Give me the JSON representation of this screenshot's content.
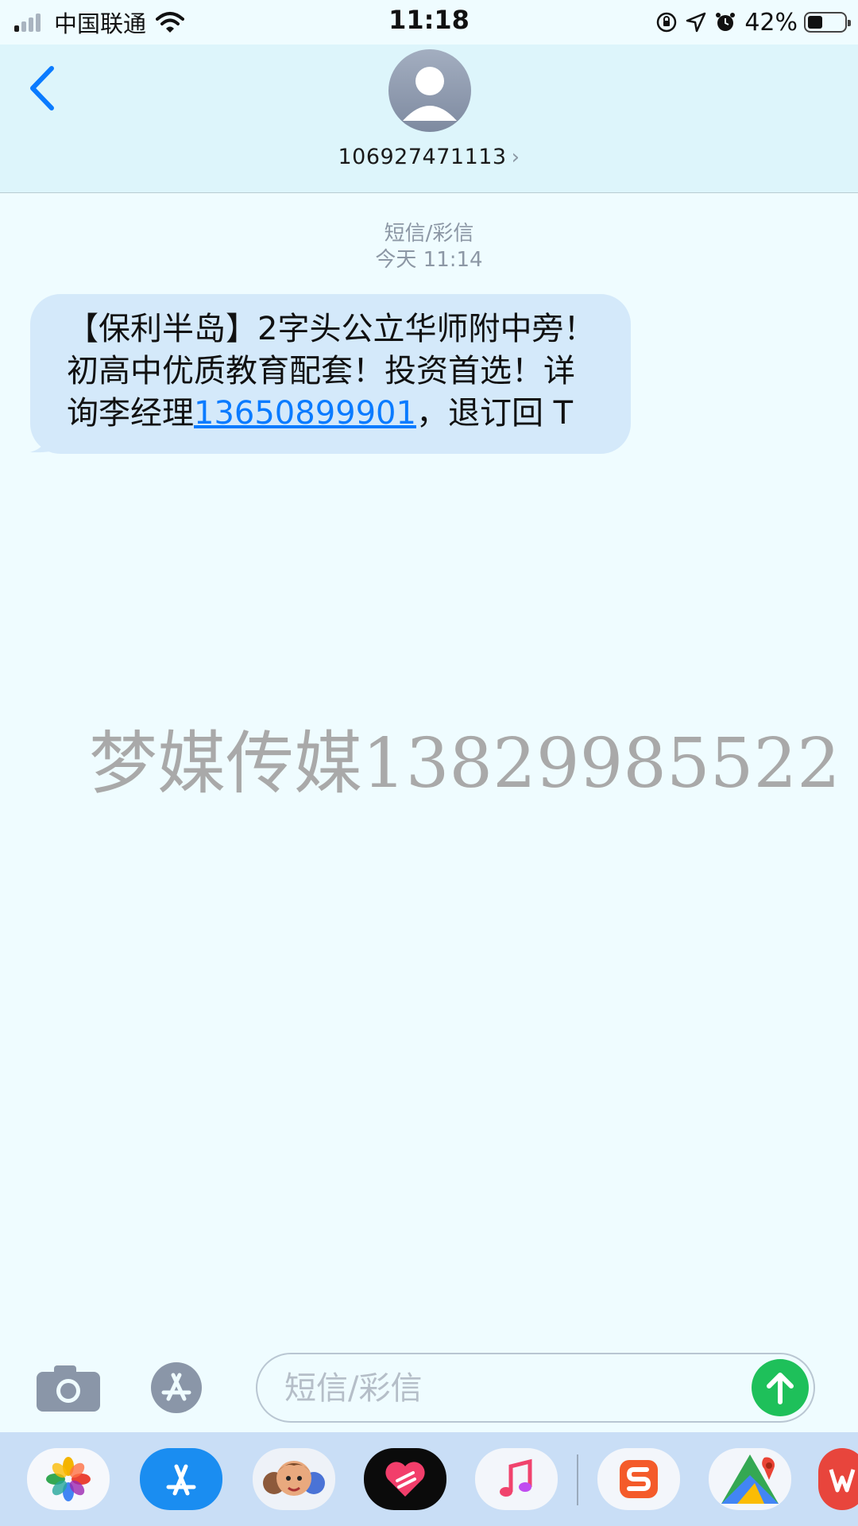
{
  "status_bar": {
    "carrier": "中国联通",
    "time": "11:18",
    "battery_percent": "42%",
    "battery_level": 0.42,
    "signal_bars_filled": 1,
    "signal_bars_total": 4
  },
  "header": {
    "contact_number": "106927471113",
    "contact_chevron": "›"
  },
  "conversation": {
    "meta_type": "短信/彩信",
    "meta_time": "今天 11:14",
    "message": {
      "text_before_link": "【保利半岛】2字头公立华师附中旁！初高中优质教育配套！投资首选！详询李经理",
      "link_text": "13650899901",
      "text_after_link": "，退订回 T"
    }
  },
  "watermark": "梦媒传媒13829985522",
  "input_bar": {
    "placeholder": "短信/彩信"
  },
  "dock": {
    "items": [
      "photos-icon",
      "app-store-icon",
      "memoji-icon",
      "digital-touch-icon",
      "music-icon",
      "sogou-icon",
      "google-maps-icon",
      "wps-icon"
    ]
  },
  "colors": {
    "accent": "#0a7bff",
    "bubble": "#d4e9fa",
    "send": "#1ec05a",
    "background": "#effcff"
  }
}
